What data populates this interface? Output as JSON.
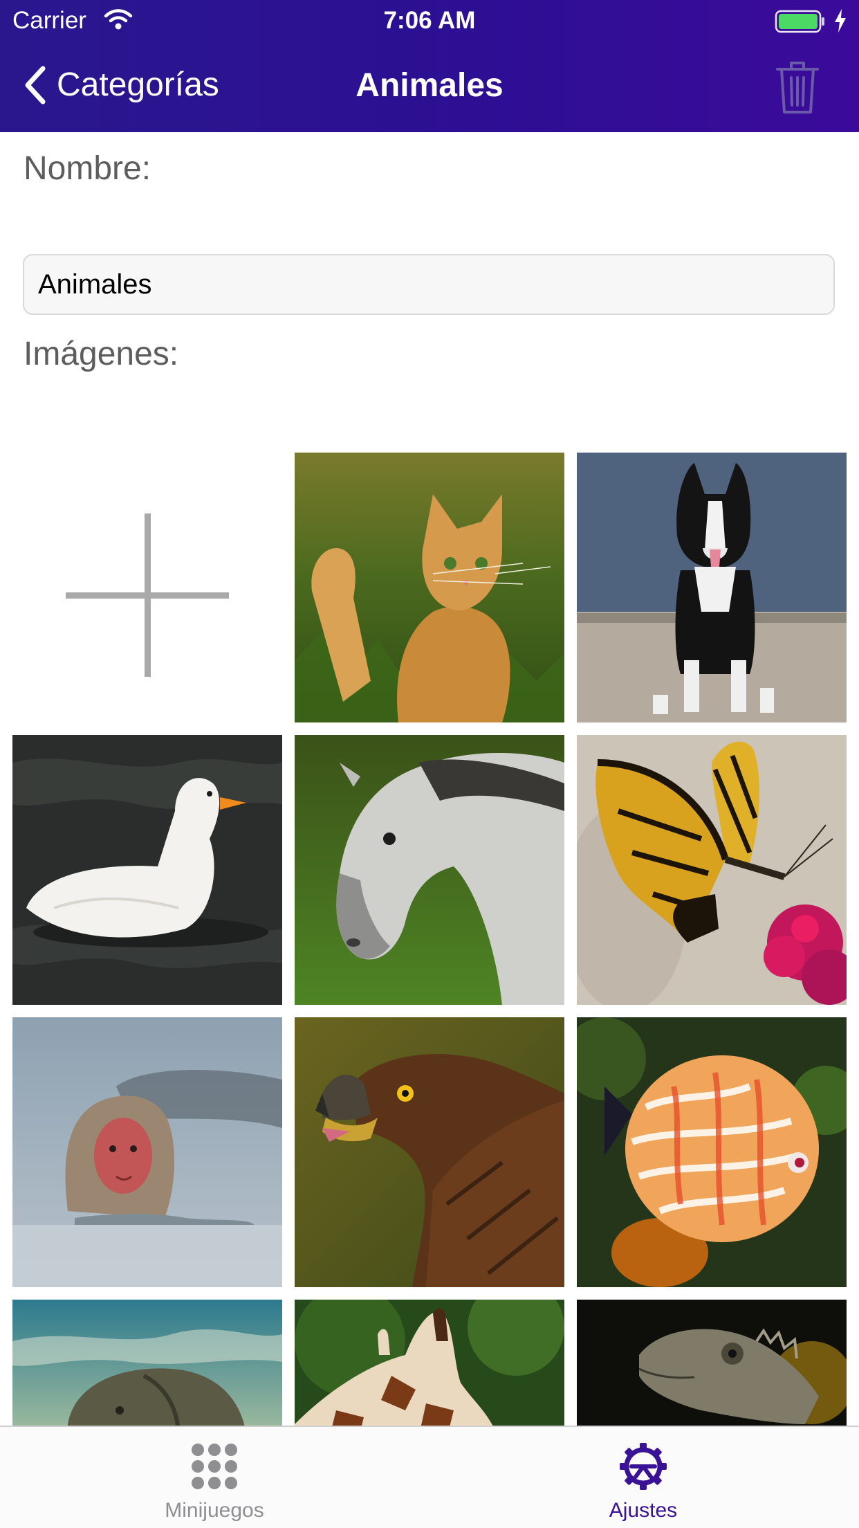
{
  "status_bar": {
    "carrier": "Carrier",
    "time": "7:06 AM",
    "battery_color": "#4cd964"
  },
  "nav": {
    "back_label": "Categorías",
    "title": "Animales",
    "trash_icon": "trash-icon"
  },
  "form": {
    "name_label": "Nombre:",
    "name_value": "Animales",
    "images_label": "Imágenes:"
  },
  "images": [
    {
      "name": "add-image",
      "icon": "plus-icon"
    },
    {
      "name": "cat"
    },
    {
      "name": "dog"
    },
    {
      "name": "duck"
    },
    {
      "name": "horse"
    },
    {
      "name": "butterfly"
    },
    {
      "name": "monkey"
    },
    {
      "name": "eagle"
    },
    {
      "name": "fish"
    },
    {
      "name": "elephant"
    },
    {
      "name": "giraffe"
    },
    {
      "name": "lizard"
    }
  ],
  "tabs": [
    {
      "label": "Minijuegos",
      "icon": "grid-dots-icon",
      "selected": false
    },
    {
      "label": "Ajustes",
      "icon": "gear-icon",
      "selected": true
    }
  ],
  "colors": {
    "nav_start": "#2a178e",
    "nav_end": "#3b0a9a",
    "accent": "#3a1296",
    "tab_inactive": "#8e8e93"
  }
}
